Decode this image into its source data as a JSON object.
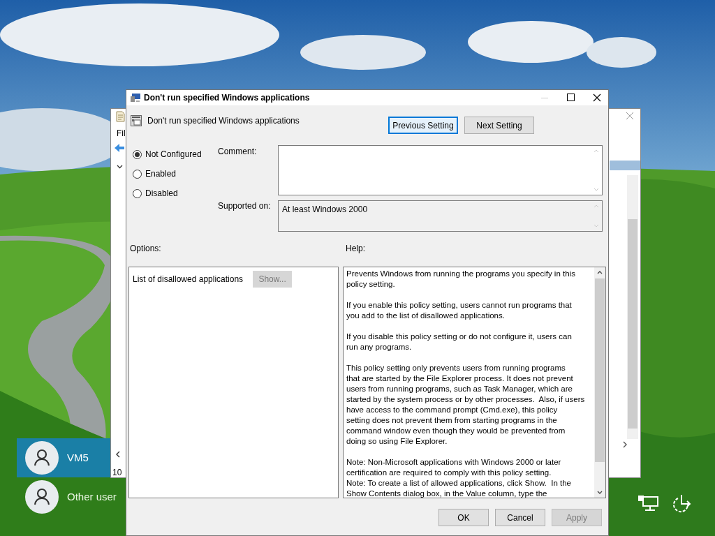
{
  "background_window": {
    "menu_fragment": "Fil",
    "status_fragment": "10"
  },
  "users": [
    {
      "name": "VM5",
      "selected": true
    },
    {
      "name": "Other user",
      "selected": false
    }
  ],
  "dialog": {
    "title": "Don't run specified Windows applications",
    "setting_name": "Don't run specified Windows applications",
    "nav_buttons": [
      {
        "label": "Previous Setting",
        "focused": true
      },
      {
        "label": "Next Setting",
        "focused": false
      }
    ],
    "states": [
      {
        "label": "Not Configured",
        "selected": true
      },
      {
        "label": "Enabled",
        "selected": false
      },
      {
        "label": "Disabled",
        "selected": false
      }
    ],
    "comment_label": "Comment:",
    "supported_label": "Supported on:",
    "supported_value": "At least Windows 2000",
    "options_label": "Options:",
    "help_label": "Help:",
    "option_items": [
      {
        "label": "List of disallowed applications",
        "button": "Show...",
        "button_disabled": true
      }
    ],
    "help_paragraphs": [
      [
        "Prevents Windows from running the programs you specify in this",
        "policy setting."
      ],
      [
        "If you enable this policy setting, users cannot run programs that",
        "you add to the list of disallowed applications."
      ],
      [
        "If you disable this policy setting or do not configure it, users can",
        "run any programs."
      ],
      [
        "This policy setting only prevents users from running programs",
        "that are started by the File Explorer process. It does not prevent",
        "users from running programs, such as Task Manager, which are",
        "started by the system process or by other processes.  Also, if users",
        "have access to the command prompt (Cmd.exe), this policy",
        "setting does not prevent them from starting programs in the",
        "command window even though they would be prevented from",
        "doing so using File Explorer."
      ],
      [
        "Note: Non-Microsoft applications with Windows 2000 or later",
        "certification are required to comply with this policy setting.",
        "Note: To create a list of allowed applications, click Show.  In the",
        "Show Contents dialog box, in the Value column, type the"
      ]
    ],
    "buttons": [
      {
        "label": "OK",
        "disabled": false
      },
      {
        "label": "Cancel",
        "disabled": false
      },
      {
        "label": "Apply",
        "disabled": true
      }
    ]
  }
}
